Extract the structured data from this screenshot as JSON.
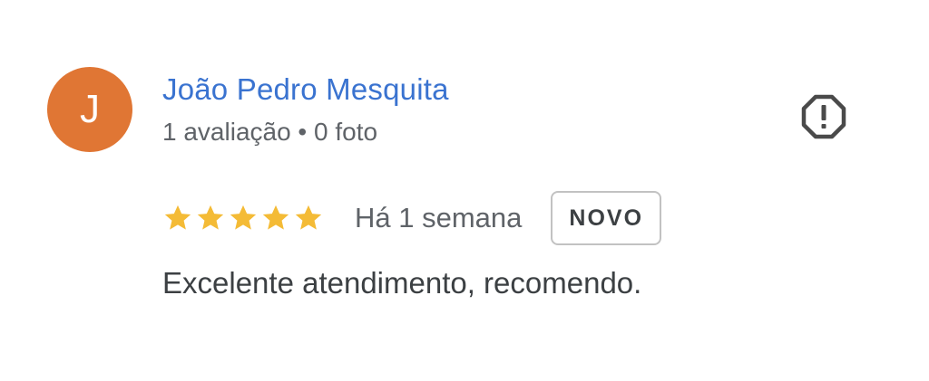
{
  "colors": {
    "avatar_bg": "#e07634",
    "author_link": "#3a73d0",
    "star": "#f4bb36",
    "icon": "#4a4a4a"
  },
  "review": {
    "avatar_initial": "J",
    "author_name": "João Pedro Mesquita",
    "author_meta": "1 avaliação • 0 foto",
    "rating": 5,
    "rating_max": 5,
    "time_ago": "Há 1 semana",
    "badge": "NOVO",
    "text": "Excelente atendimento, recomendo."
  },
  "icons": {
    "report": "alert-octagon-icon",
    "star": "star-icon"
  }
}
